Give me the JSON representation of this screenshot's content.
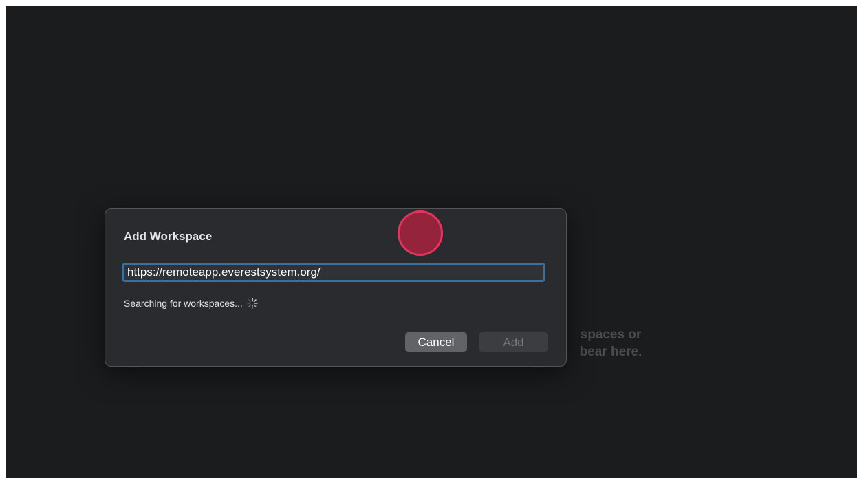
{
  "background": {
    "empty_state_lines": [
      "spaces or",
      "bear here."
    ]
  },
  "dialog": {
    "title": "Add Workspace",
    "url_value": "https://remoteapp.everestsystem.org/",
    "status_text": "Searching for workspaces...",
    "status_icon": "spinner-icon",
    "cancel_label": "Cancel",
    "add_label": "Add"
  },
  "colors": {
    "window_bg": "#1b1c1e",
    "dialog_bg": "#2a2b2e",
    "focus_ring": "#3b6f9e",
    "cancel_bg": "#626366",
    "add_bg_disabled": "#3c3d40",
    "click_marker": "#e3345c"
  }
}
